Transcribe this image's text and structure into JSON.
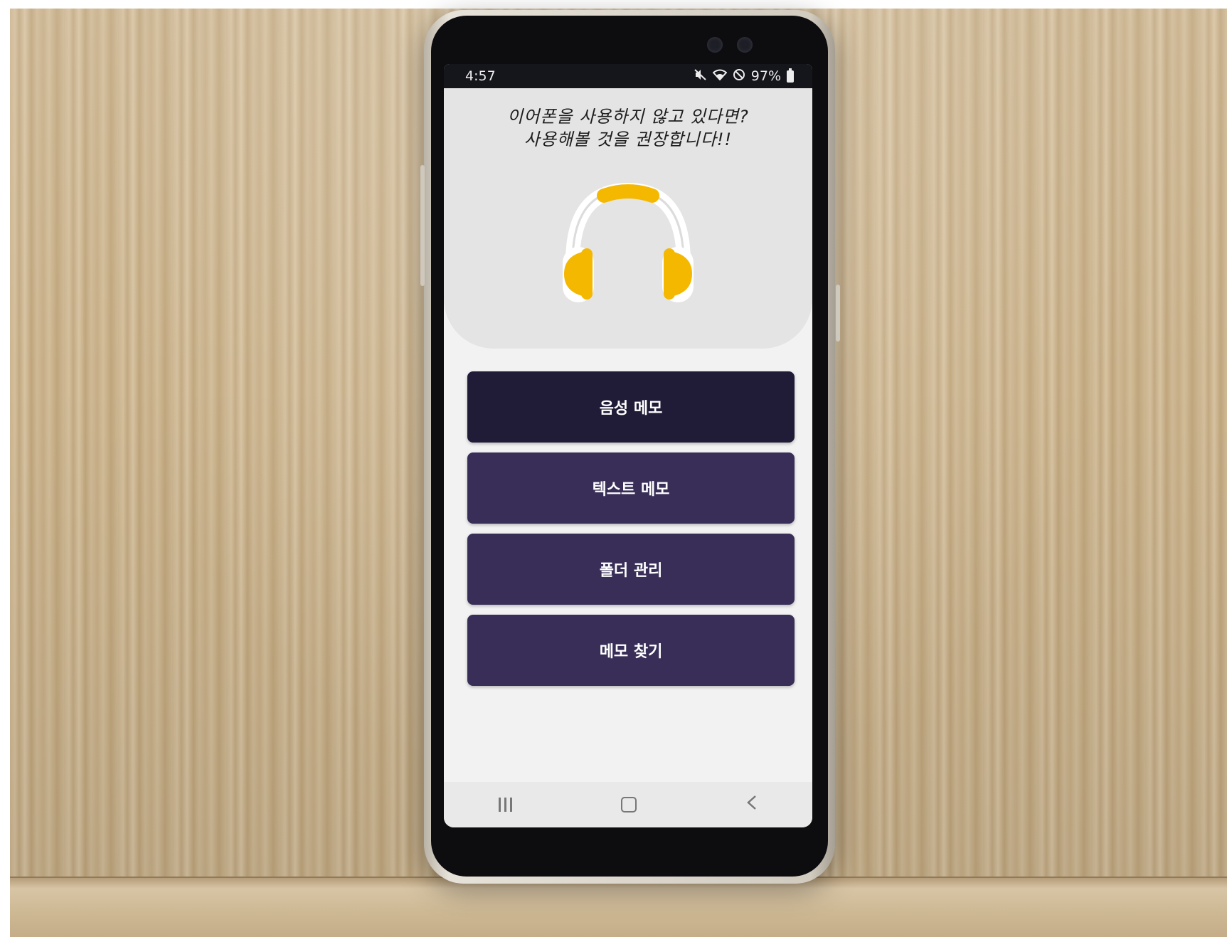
{
  "status_bar": {
    "time": "4:57",
    "battery": "97%",
    "icons": [
      "mute-icon",
      "wifi-icon",
      "blocked-icon",
      "battery-icon"
    ]
  },
  "hero": {
    "line1": "이어폰을 사용하지 않고 있다면?",
    "line2": "사용해볼 것을 권장합니다!!",
    "icon": "headphones-icon",
    "accent_color": "#F5B800"
  },
  "menu": {
    "buttons": [
      {
        "label": "음성 메모"
      },
      {
        "label": "텍스트 메모"
      },
      {
        "label": "폴더 관리"
      },
      {
        "label": "메모 찾기"
      }
    ],
    "colors": {
      "primary": "#382E57",
      "pressed": "#201C38"
    }
  },
  "navbar": {
    "icons": [
      "recent-apps-icon",
      "home-icon",
      "back-icon"
    ]
  }
}
